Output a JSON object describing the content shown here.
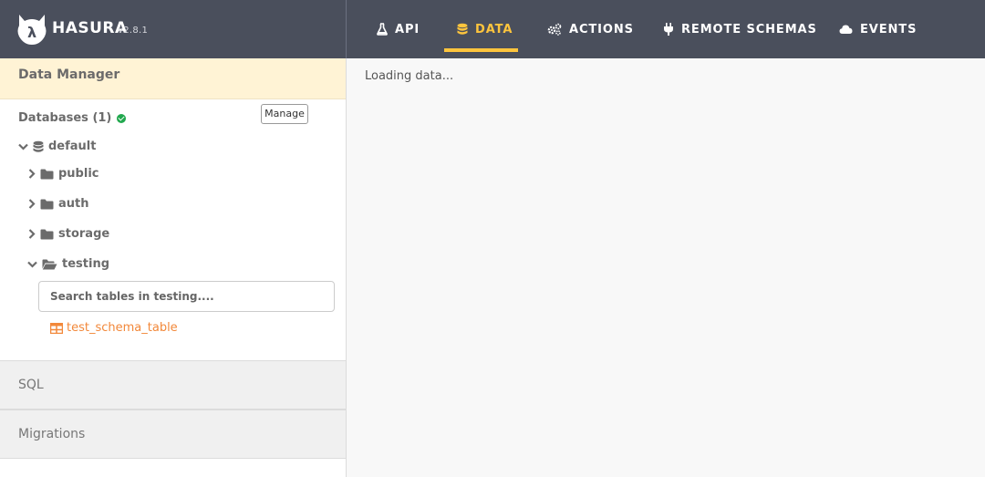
{
  "brand": {
    "logo": "HASURA",
    "version": "v2.8.1",
    "logo_icon": "hasura-cat-icon"
  },
  "nav": {
    "api": "API",
    "data": "DATA",
    "actions": "ACTIONS",
    "remote_schemas": "REMOTE SCHEMAS",
    "events": "EVENTS",
    "active": "DATA",
    "accent_color": "#fec53d"
  },
  "sidebar": {
    "section_title": "Data Manager",
    "databases_label": "Databases (1)",
    "manage_label": "Manage",
    "database": "default",
    "schemas": [
      "public",
      "auth",
      "storage",
      "testing"
    ],
    "search_placeholder": "Search tables in testing....",
    "table": "test_schema_table",
    "sql_label": "SQL",
    "migrations_label": "Migrations",
    "table_color": "#f2883a",
    "status_color": "#21a84e"
  },
  "main": {
    "loading_text": "Loading data..."
  }
}
